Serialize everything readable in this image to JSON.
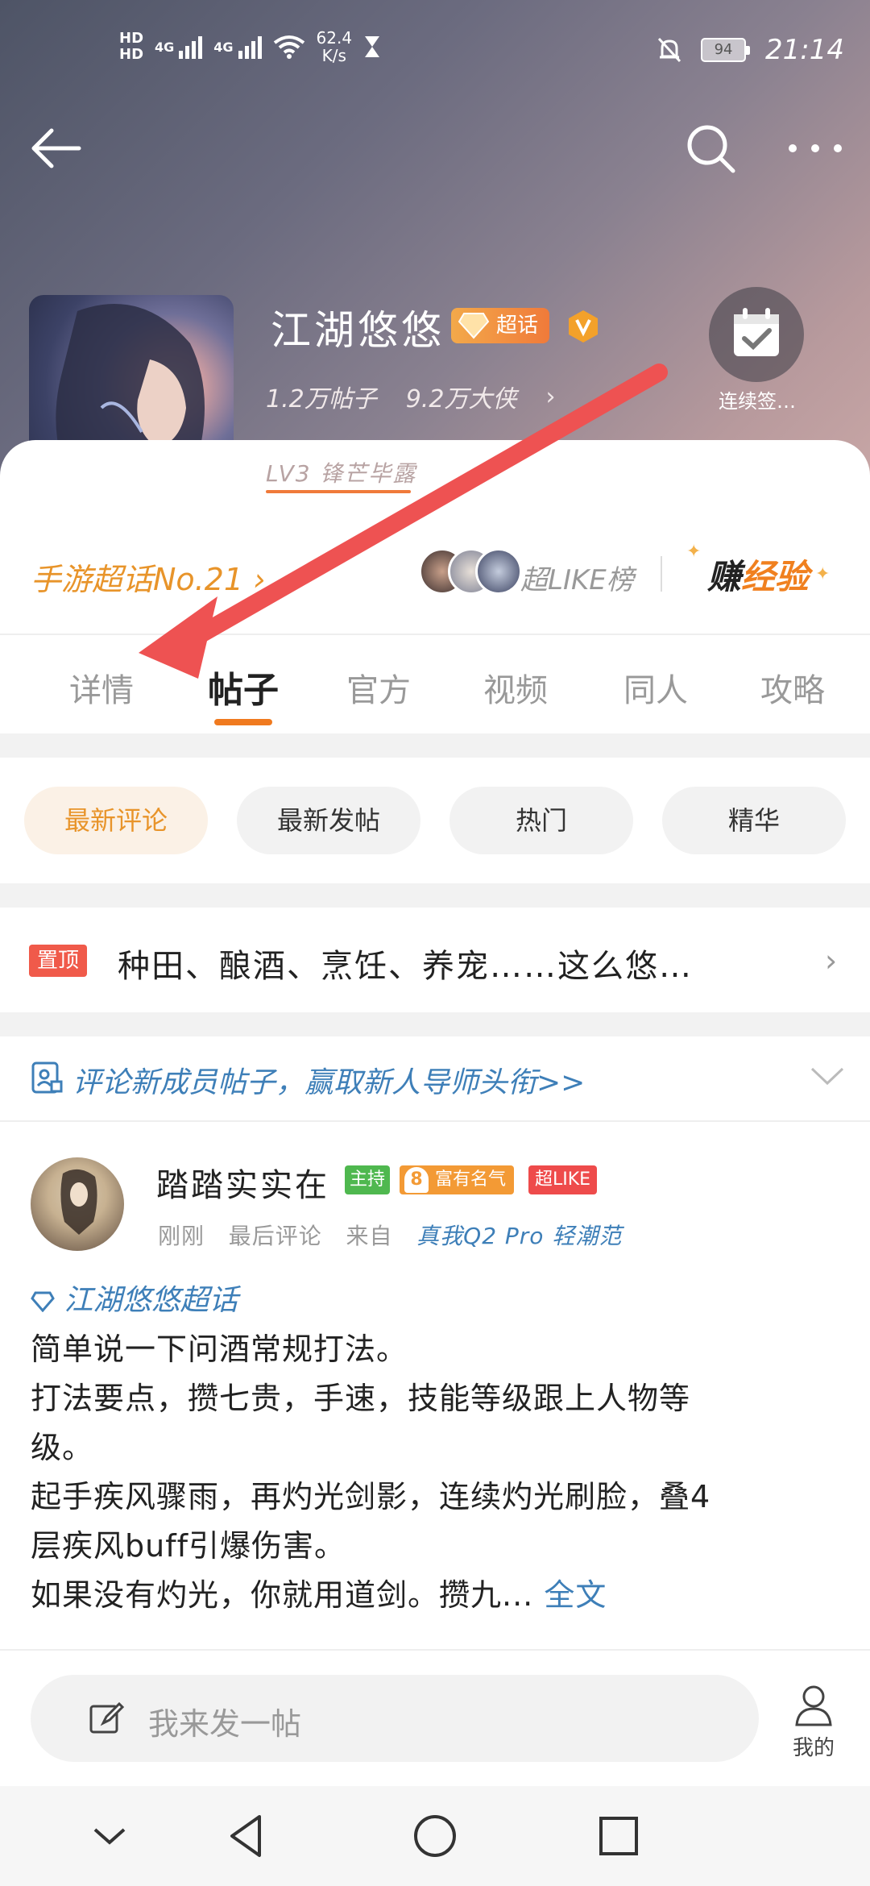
{
  "status_bar": {
    "hd1": "HD",
    "hd2": "HD",
    "net1": "4G",
    "net2": "4G",
    "speed_value": "62.4",
    "speed_unit": "K/s",
    "battery": "94",
    "time": "21:14"
  },
  "topbar": {
    "back_icon": "arrow-left-icon",
    "search_icon": "search-icon",
    "more_icon": "more-dots-icon"
  },
  "community": {
    "name": "江湖悠悠",
    "badge_chaohua": "超话",
    "posts_stat": "1.2万帖子",
    "members_stat": "9.2万大侠",
    "checkin_label": "连续签…",
    "level": "LV3 锋芒毕露",
    "rank": "手游超话No.21",
    "like_board": "超LIKE榜",
    "earn_exp_prefix": "赚",
    "earn_exp_highlight": "经验"
  },
  "tabs": [
    "详情",
    "帖子",
    "官方",
    "视频",
    "同人",
    "攻略"
  ],
  "active_tab": "帖子",
  "filters": [
    "最新评论",
    "最新发帖",
    "热门",
    "精华"
  ],
  "pinned": {
    "tag": "置顶",
    "text": "种田、酿酒、烹饪、养宠……这么悠…"
  },
  "notice": {
    "text": "评论新成员帖子，赢取新人导师头衔>>"
  },
  "post": {
    "author": "踏踏实实在",
    "badge_host": "主持",
    "fame_level": "8",
    "badge_fame": "富有名气",
    "badge_like": "超LIKE",
    "meta_time": "刚刚",
    "meta_action": "最后评论",
    "meta_from": "来自",
    "meta_source": "真我Q2 Pro 轻潮范",
    "chaohua_link": "江湖悠悠超话",
    "lines": [
      "简单说一下问酒常规打法。",
      "打法要点，攒七贵，手速，技能等级跟上人物等",
      "级。",
      "起手疾风骤雨，再灼光剑影，连续灼光刷脸，叠4",
      "层疾风buff引爆伤害。",
      "如果没有灼光，你就用道剑。攒九..."
    ],
    "full_text_label": "全文"
  },
  "compose": {
    "placeholder": "我来发一帖",
    "mine_label": "我的"
  },
  "colors": {
    "accent": "#f07a1f",
    "link": "#3e7fb8",
    "annotation_arrow": "#ee4b4b"
  }
}
